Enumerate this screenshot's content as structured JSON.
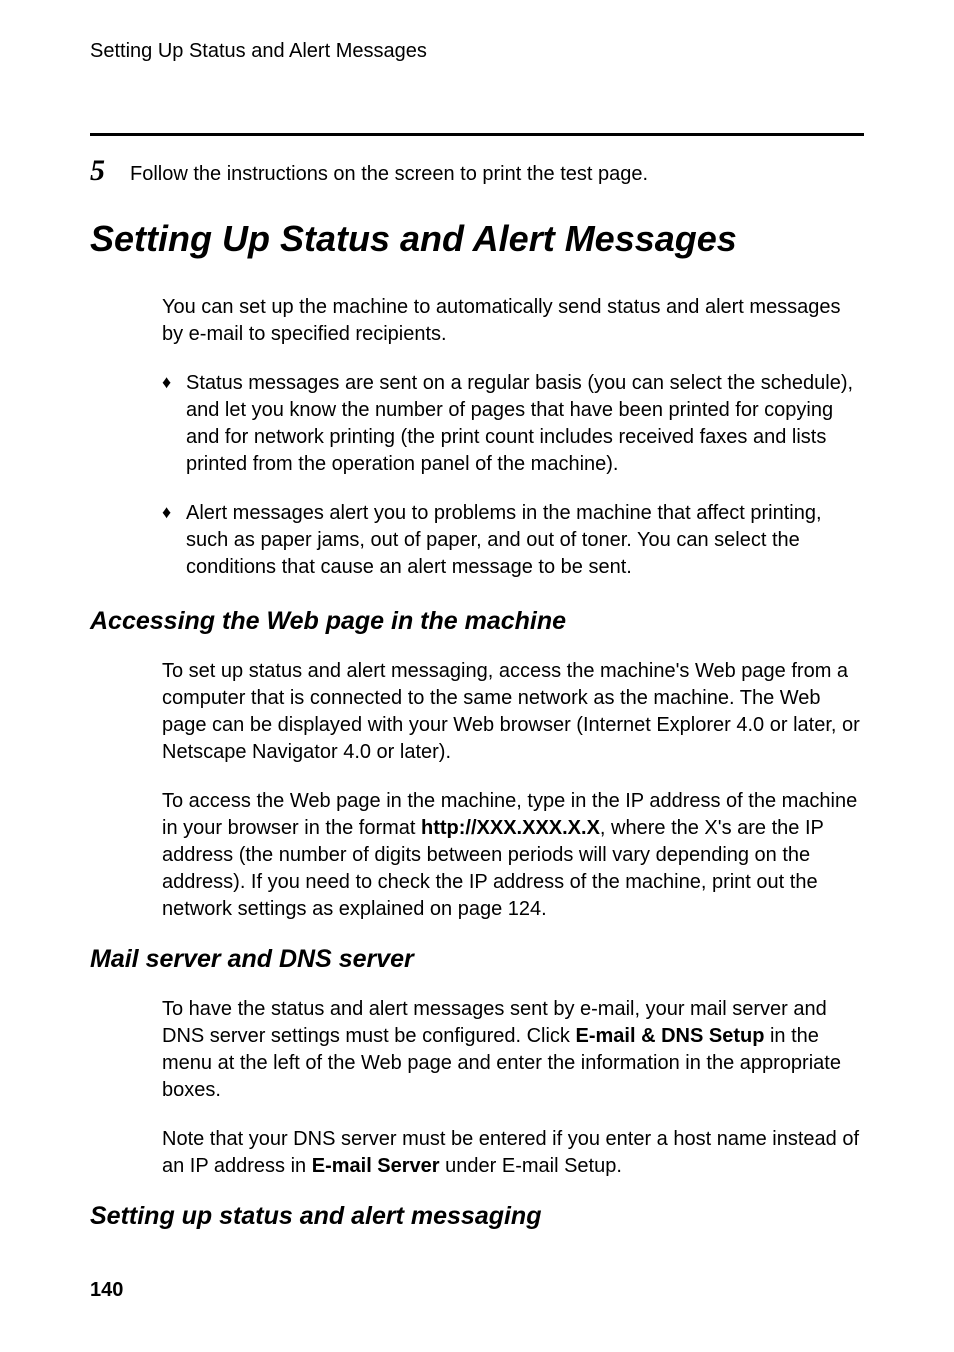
{
  "runningHead": "Setting Up Status and Alert Messages",
  "step": {
    "num": "5",
    "text": "Follow the instructions on the screen to print the test page."
  },
  "title": "Setting Up Status and Alert Messages",
  "intro": "You can set up the machine to automatically send status and alert messages by e-mail to specified recipients.",
  "bullets": [
    "Status messages are sent on a regular basis (you can select the schedule), and let you know the number of pages that have been printed for copying and for network printing (the print count includes received faxes and lists printed from the operation panel of the machine).",
    "Alert messages alert you to problems in the machine that affect printing, such as paper jams, out of paper, and out of toner. You can select the conditions that cause an alert message to be sent."
  ],
  "sections": {
    "access": {
      "heading": "Accessing the Web page in the machine",
      "p1": "To set up status and alert messaging, access the machine's Web page from a computer that is connected to the same network as the machine. The Web page can be displayed with your Web browser (Internet Explorer 4.0 or later, or Netscape Navigator 4.0 or later).",
      "p2_pre": "To access the Web page in the machine, type in the IP address of the machine in your browser in the format ",
      "p2_bold": "http://XXX.XXX.X.X",
      "p2_post": ", where the X's are the IP address (the number of digits between periods will vary depending on the address). If you need to check the IP address of the machine, print out the network settings as explained on page 124."
    },
    "mail": {
      "heading": "Mail server and DNS server",
      "p1_pre": "To have the status and alert messages sent by e-mail,  your mail server and DNS server settings must be configured. Click ",
      "p1_bold": "E-mail & DNS Setup",
      "p1_post": " in the menu at the left of the Web page and enter the information in the appropriate boxes.",
      "p2_pre": "Note that your DNS server must be entered if you enter a host name instead of an IP address in ",
      "p2_bold": "E-mail Server",
      "p2_post": " under E-mail Setup."
    },
    "setup": {
      "heading": "Setting up status and alert messaging"
    }
  },
  "pageNumber": "140"
}
